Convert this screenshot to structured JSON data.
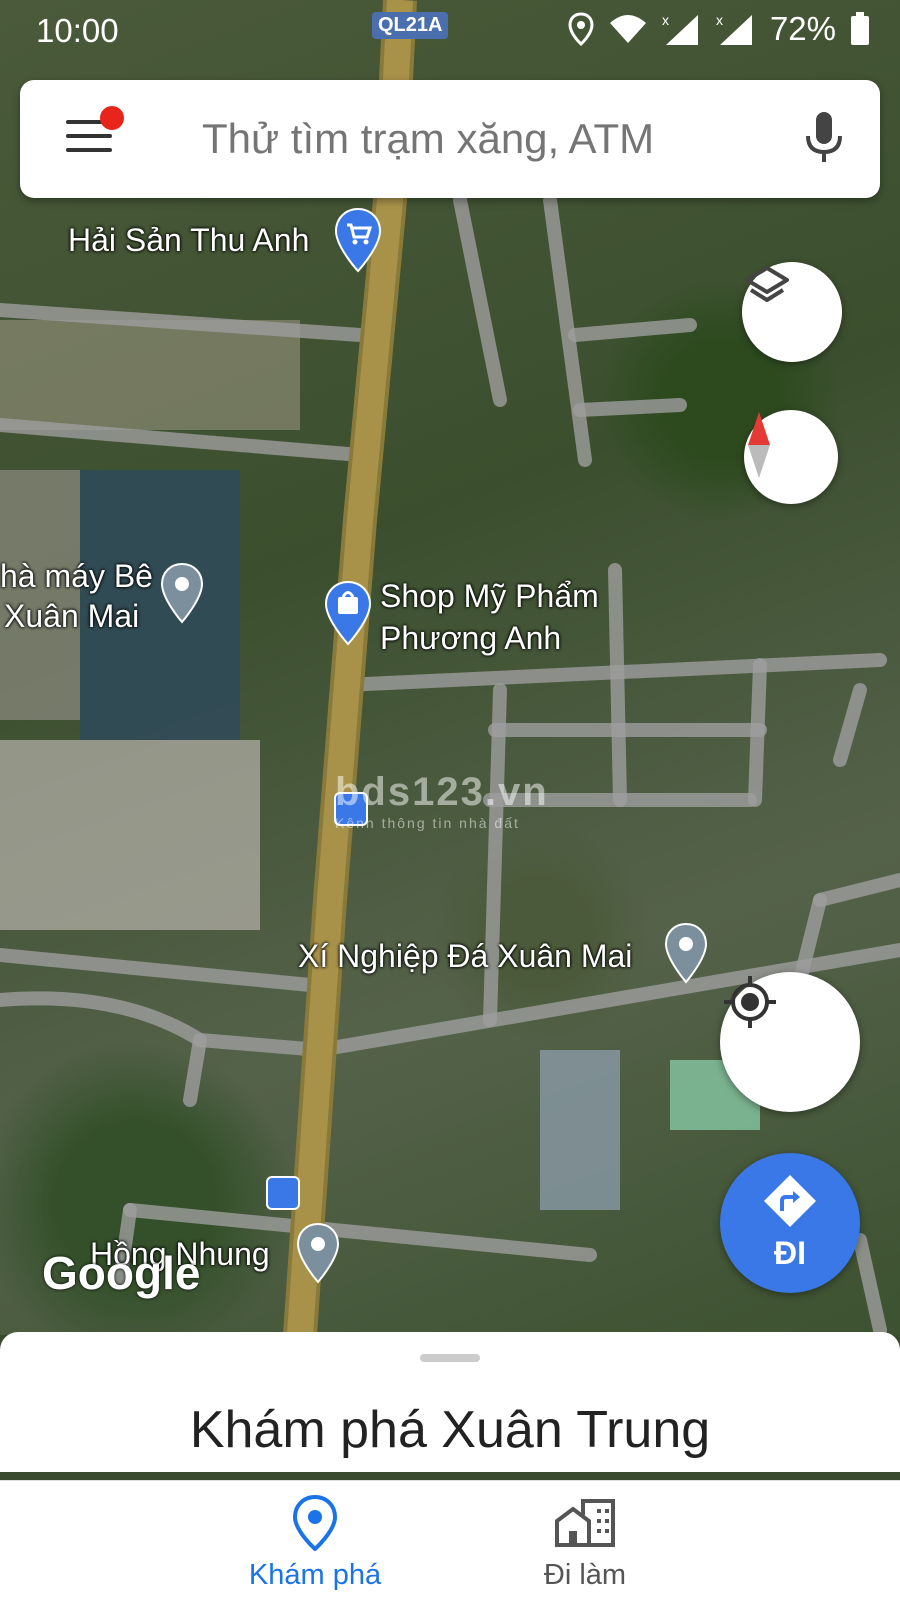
{
  "status": {
    "time": "10:00",
    "battery": "72%"
  },
  "search": {
    "placeholder": "Thử tìm trạm xăng, ATM"
  },
  "map": {
    "road_shield": "QL21A",
    "labels": {
      "hai_san": "Hải Sản Thu Anh",
      "nha_may_1": "hà máy Bê",
      "nha_may_2": "Xuân Mai",
      "shop_1": "Shop Mỹ Phẩm",
      "shop_2": "Phương Anh",
      "xi_nghiep": "Xí Nghiệp Đá Xuân Mai",
      "hong_nhung": "Hồng Nhung"
    },
    "watermark": {
      "title": "bds123.vn",
      "subtitle": "Kênh thông tin nhà đất"
    },
    "google_logo": "Google",
    "go_label": "ĐI"
  },
  "sheet": {
    "title": "Khám phá Xuân Trung"
  },
  "bottom_nav": [
    {
      "label": "Khám phá",
      "icon": "location-pin-icon",
      "active": true
    },
    {
      "label": "Đi làm",
      "icon": "buildings-icon",
      "active": false
    }
  ],
  "colors": {
    "accent": "#1a73e8",
    "go_button": "#3b78e7",
    "notification_dot": "#e8251b",
    "compass_red": "#e53935"
  }
}
